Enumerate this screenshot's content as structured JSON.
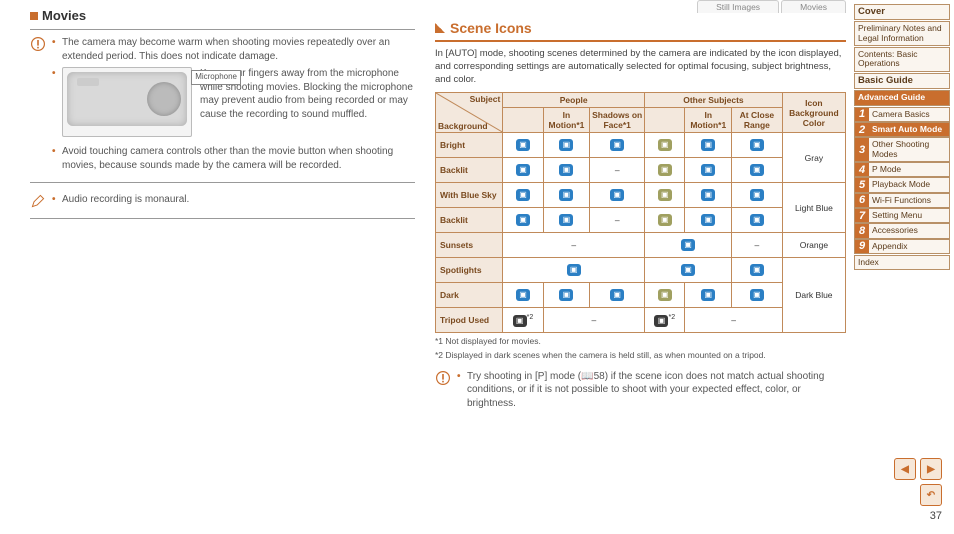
{
  "left": {
    "heading": "Movies",
    "bullets": [
      "The camera may become warm when shooting movies repeatedly over an extended period. This does not indicate damage.",
      "Keep your fingers away from the microphone while shooting movies. Blocking the microphone may prevent audio from being recorded or may cause the recording to sound muffled.",
      "Avoid touching camera controls other than the movie button when shooting movies, because sounds made by the camera will be recorded."
    ],
    "mic_label": "Microphone",
    "pencil_note": "Audio recording is monaural."
  },
  "right": {
    "tag_still": "Still Images",
    "tag_movies": "Movies",
    "title": "Scene Icons",
    "intro": "In [AUTO] mode, shooting scenes determined by the camera are indicated by the icon displayed, and corresponding settings are automatically selected for optimal focusing, subject brightness, and color.",
    "table": {
      "head": {
        "subject": "Subject",
        "background": "Background",
        "people": "People",
        "other": "Other Subjects",
        "icon_bg": "Icon Background Color",
        "p1": "",
        "p2": "In Motion*1",
        "p3": "Shadows on Face*1",
        "o1": "",
        "o2": "In Motion*1",
        "o3": "At Close Range"
      },
      "rows": [
        {
          "bg": "Bright",
          "p1": "👤",
          "p2": "👤",
          "p3": "👤",
          "o1": "AUTO",
          "o2": "📷",
          "o3": "🌼",
          "color": "Gray",
          "merge": true
        },
        {
          "bg": "Backlit",
          "p1": "👤",
          "p2": "👤",
          "p3": "–",
          "o1": "📷",
          "o2": "📷",
          "o3": "🌼",
          "color": ""
        },
        {
          "bg": "With Blue Sky",
          "p1": "👤",
          "p2": "👤",
          "p3": "👤",
          "o1": "AUTO",
          "o2": "📷",
          "o3": "🌼",
          "color": "Light Blue",
          "merge": true
        },
        {
          "bg": "Backlit",
          "p1": "👤",
          "p2": "👤",
          "p3": "–",
          "o1": "📷",
          "o2": "📷",
          "o3": "🌼",
          "color": ""
        },
        {
          "bg": "Sunsets",
          "p1": "–",
          "p2": "",
          "p3": "",
          "o1": "🌅",
          "o2": "",
          "o3": "–",
          "color": "Orange",
          "span": true
        },
        {
          "bg": "Spotlights",
          "p1": "👤",
          "p2": "",
          "p3": "",
          "o1": "🎯",
          "o2": "",
          "o3": "🌼",
          "color": "Dark Blue",
          "span": true,
          "merge": true
        },
        {
          "bg": "Dark",
          "p1": "👤",
          "p2": "👤",
          "p3": "👤",
          "o1": "AUTO",
          "o2": "📷",
          "o3": "🌼",
          "color": ""
        },
        {
          "bg": "Tripod Used",
          "p1": "👤*2",
          "p2": "–",
          "p3": "",
          "o1": "🌙*2",
          "o2": "–",
          "o3": "",
          "color": "",
          "span2": true
        }
      ]
    },
    "note1": "*1 Not displayed for movies.",
    "note2": "*2 Displayed in dark scenes when the camera is held still, as when mounted on a tripod.",
    "warn_tip": "Try shooting in [P] mode (📖58) if the scene icon does not match actual shooting conditions, or if it is not possible to shoot with your expected effect, color, or brightness."
  },
  "nav": {
    "cover": "Cover",
    "prelim": "Preliminary Notes and Legal Information",
    "contents": "Contents: Basic Operations",
    "basic": "Basic Guide",
    "advanced": "Advanced Guide",
    "items": [
      {
        "n": "1",
        "t": "Camera Basics"
      },
      {
        "n": "2",
        "t": "Smart Auto Mode"
      },
      {
        "n": "3",
        "t": "Other Shooting Modes"
      },
      {
        "n": "4",
        "t": "P Mode"
      },
      {
        "n": "5",
        "t": "Playback Mode"
      },
      {
        "n": "6",
        "t": "Wi-Fi Functions"
      },
      {
        "n": "7",
        "t": "Setting Menu"
      },
      {
        "n": "8",
        "t": "Accessories"
      },
      {
        "n": "9",
        "t": "Appendix"
      }
    ],
    "index": "Index"
  },
  "page_number": "37"
}
